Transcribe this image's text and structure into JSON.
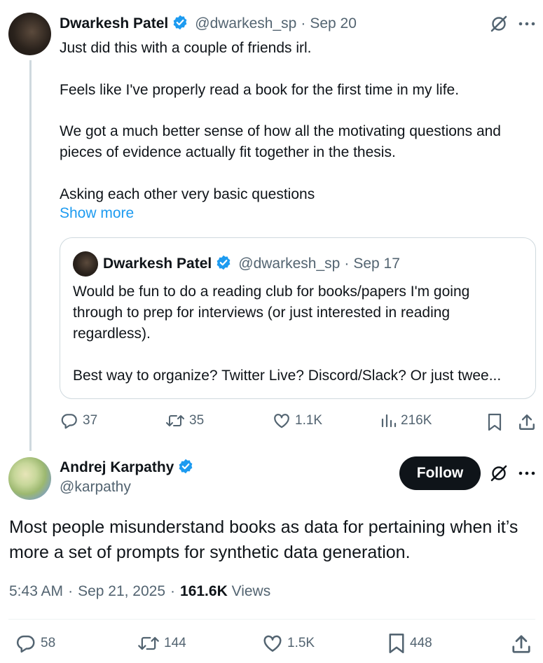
{
  "reply_tweet": {
    "author_name": "Dwarkesh Patel",
    "handle": "@dwarkesh_sp",
    "separator": "·",
    "date": "Sep 20",
    "lines": [
      "Just did this with a couple of friends irl.",
      "Feels like I've properly read a book for the first time in my life.",
      "We got a much better sense of how all the motivating questions and",
      "pieces of evidence actually fit together in the thesis.",
      "Asking each other very basic questions"
    ],
    "show_more": "Show more",
    "quote": {
      "author_name": "Dwarkesh Patel",
      "handle": "@dwarkesh_sp",
      "separator": "·",
      "date": "Sep 17",
      "lines": [
        "Would be fun to do a reading club for books/papers I'm going",
        "through to prep for interviews (or just interested in reading",
        "regardless).",
        "Best way to organize? Twitter Live? Discord/Slack? Or just twee..."
      ]
    },
    "actions": {
      "replies": "37",
      "reposts": "35",
      "likes": "1.1K",
      "views": "216K"
    }
  },
  "main_tweet": {
    "author_name": "Andrej Karpathy",
    "handle": "@karpathy",
    "follow_label": "Follow",
    "lines": [
      "Most people misunderstand books as data for pertaining when it’s",
      "more a set of prompts for synthetic data generation."
    ],
    "time": "5:43 AM",
    "separator": "·",
    "date": "Sep 21, 2025",
    "separator2": "·",
    "views_count": "161.6K",
    "views_label": "Views",
    "actions": {
      "replies": "58",
      "reposts": "144",
      "likes": "1.5K",
      "bookmarks": "448"
    }
  },
  "colors": {
    "accent": "#1d9bf0",
    "text": "#0f1419",
    "muted": "#536471",
    "border": "#cfd9de"
  }
}
